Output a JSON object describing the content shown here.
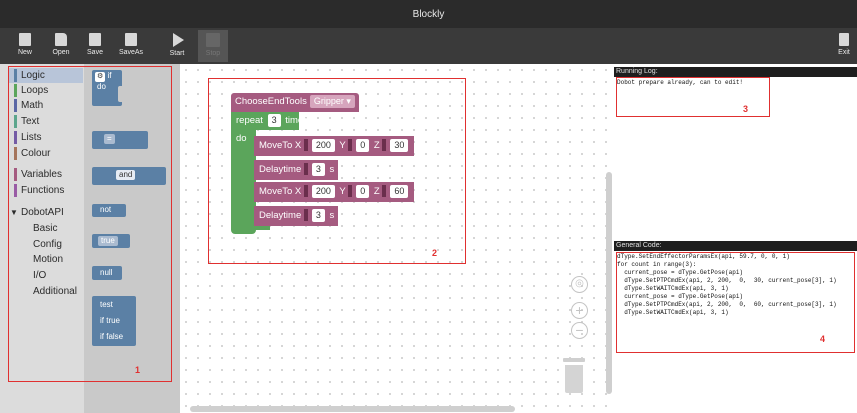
{
  "window": {
    "title": "Blockly"
  },
  "toolbar": {
    "new": "New",
    "open": "Open",
    "save": "Save",
    "saveas": "SaveAs",
    "start": "Start",
    "stop": "Stop",
    "exit": "Exit"
  },
  "toolbox": {
    "categories": [
      {
        "label": "Logic",
        "color": "#5b80a5"
      },
      {
        "label": "Loops",
        "color": "#5ba55b"
      },
      {
        "label": "Math",
        "color": "#5b67a5"
      },
      {
        "label": "Text",
        "color": "#5ba58c"
      },
      {
        "label": "Lists",
        "color": "#745ba5"
      },
      {
        "label": "Colour",
        "color": "#a5745b"
      },
      {
        "label": "Variables",
        "color": "#a55b80"
      },
      {
        "label": "Functions",
        "color": "#995ba5"
      },
      {
        "label": "DobotAPI",
        "color": ""
      },
      {
        "label": "Basic",
        "color": ""
      },
      {
        "label": "Config",
        "color": ""
      },
      {
        "label": "Motion",
        "color": ""
      },
      {
        "label": "I/O",
        "color": ""
      },
      {
        "label": "Additional",
        "color": ""
      }
    ]
  },
  "flyout": {
    "if_label": "if",
    "do_label": "do",
    "compare_op": "=",
    "logic_op": "and",
    "not_label": "not",
    "bool_value": "true",
    "null_label": "null",
    "ternary": {
      "test": "test",
      "if_true": "if true",
      "if_false": "if false"
    }
  },
  "workspace": {
    "choose_tools": {
      "label": "ChooseEndTools",
      "value": "Gripper"
    },
    "repeat": {
      "label": "repeat",
      "count": "3",
      "suffix": "times",
      "do_label": "do"
    },
    "moveto1": {
      "label": "MoveTo",
      "x_label": "X",
      "x": "200",
      "y_label": "Y",
      "y": "0",
      "z_label": "Z",
      "z": "30"
    },
    "delay1": {
      "label": "Delaytime",
      "value": "3",
      "unit": "s"
    },
    "moveto2": {
      "label": "MoveTo",
      "x_label": "X",
      "x": "200",
      "y_label": "Y",
      "y": "0",
      "z_label": "Z",
      "z": "60"
    },
    "delay2": {
      "label": "Delaytime",
      "value": "3",
      "unit": "s"
    }
  },
  "running_log": {
    "title": "Running Log:",
    "text": "Dobot prepare already, can to edit!"
  },
  "general_code": {
    "title": "General Code:",
    "lines": [
      "dType.SetEndEffectorParamsEx(api, 59.7, 0, 0, 1)",
      "for count in range(3):",
      "  current_pose = dType.GetPose(api)",
      "  dType.SetPTPCmdEx(api, 2, 200,  0,  30, current_pose[3], 1)",
      "  dType.SetWAITCmdEx(api, 3, 1)",
      "  current_pose = dType.GetPose(api)",
      "  dType.SetPTPCmdEx(api, 2, 200,  0,  60, current_pose[3], 1)",
      "  dType.SetWAITCmdEx(api, 3, 1)"
    ]
  },
  "annotations": [
    "1",
    "2",
    "3",
    "4"
  ],
  "colors": {
    "accent": "#e03030",
    "logic": "#5b80a5",
    "loops": "#5ba55b",
    "dobot": "#a55b80"
  }
}
